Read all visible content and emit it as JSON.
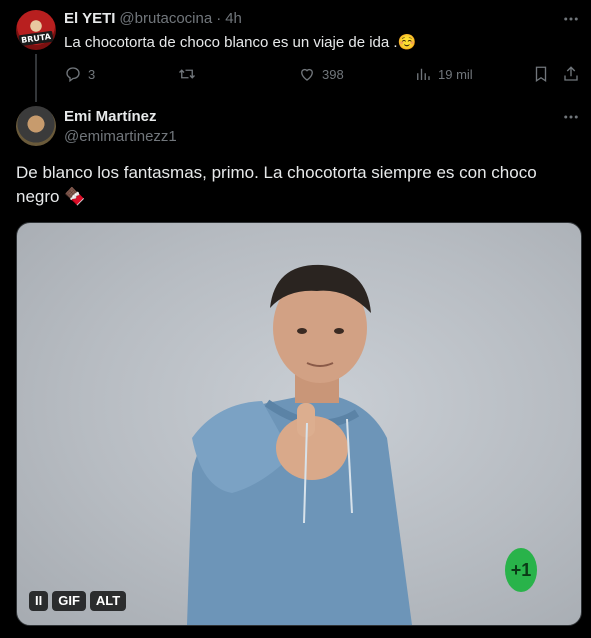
{
  "reply": {
    "name": "El YETI",
    "handle": "@brutacocina",
    "separator": "·",
    "time": "4h",
    "text": "La chocotorta de choco blanco es un viaje de ida .☺️",
    "avatar_text": "BRUTA",
    "actions": {
      "replies": "3",
      "likes": "398",
      "views": "19 mil"
    }
  },
  "main": {
    "name": "Emi Martínez",
    "handle": "@emimartinezz1",
    "text": "De blanco los fantasmas, primo. La chocotorta siempre es con choco negro 🍫",
    "media": {
      "pause_label": "II",
      "gif_label": "GIF",
      "alt_label": "ALT",
      "badge_text": "+1"
    }
  },
  "colors": {
    "background": "#000000",
    "primary_text": "#e7e9ea",
    "secondary_text": "#71767b",
    "badge_green": "#29b34a"
  },
  "icons": [
    "more-icon",
    "reply-icon",
    "retweet-icon",
    "like-icon",
    "views-icon",
    "bookmark-icon",
    "share-icon"
  ]
}
